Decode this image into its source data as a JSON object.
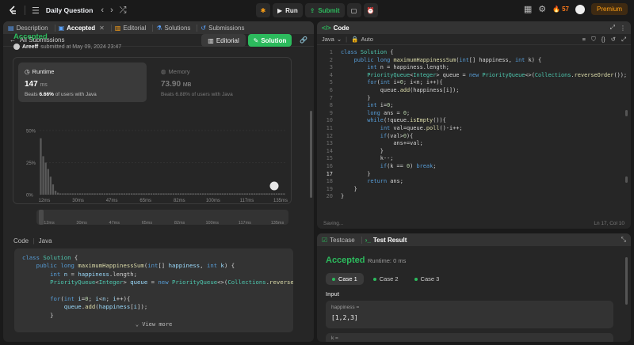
{
  "topbar": {
    "title": "Daily Question",
    "run_label": "Run",
    "submit_label": "Submit",
    "streak": "57",
    "premium_label": "Premium"
  },
  "left_tabs": [
    {
      "label": "Description"
    },
    {
      "label": "Accepted"
    },
    {
      "label": "Editorial"
    },
    {
      "label": "Solutions"
    },
    {
      "label": "Submissions"
    }
  ],
  "submission": {
    "back_label": "All Submissions",
    "status": "Accepted",
    "author": "Areeff",
    "submitted_text": "submitted at May 09, 2024 23:47",
    "editorial_button": "Editorial",
    "solution_button": "Solution"
  },
  "runtime": {
    "label": "Runtime",
    "value": "147",
    "unit": "ms",
    "beats_prefix": "Beats",
    "beats_value": "6.66%",
    "beats_suffix": "of users with Java"
  },
  "memory": {
    "label": "Memory",
    "value": "73.90",
    "unit": "MB",
    "beats_text": "Beats 6.88% of users with Java"
  },
  "chart_data": {
    "type": "bar",
    "y_ticks": [
      "50%",
      "25%",
      "0%"
    ],
    "ylim": [
      0,
      50
    ],
    "x_tick_labels": [
      "12ms",
      "30ms",
      "47ms",
      "65ms",
      "82ms",
      "100ms",
      "117ms",
      "135ms"
    ],
    "overview_tick_labels": [
      "12ms",
      "30ms",
      "47ms",
      "65ms",
      "82ms",
      "100ms",
      "117ms",
      "135ms"
    ],
    "bars": [
      44,
      30,
      25,
      20,
      14,
      8,
      3,
      1.5,
      1,
      1,
      1,
      1,
      1,
      1,
      1,
      1,
      1,
      1,
      1,
      1,
      1,
      1,
      1,
      1,
      1,
      1,
      1,
      1,
      1,
      1,
      1,
      1,
      1,
      1,
      1,
      1,
      1,
      1,
      1,
      1,
      1,
      1,
      1,
      1,
      1,
      1,
      1,
      1,
      1,
      1,
      1,
      1,
      1,
      1,
      1,
      1,
      1,
      1,
      1,
      1,
      1,
      1,
      1,
      1,
      1,
      1,
      1,
      1,
      1,
      1,
      1,
      1,
      1,
      1,
      1,
      1,
      1,
      1,
      1,
      1,
      1,
      1,
      1,
      1,
      1,
      1,
      1,
      1,
      1,
      1,
      1,
      1,
      1,
      1,
      1,
      1,
      1,
      1,
      1,
      1
    ],
    "grid": true
  },
  "code_preview": {
    "label": "Code",
    "language": "Java",
    "lines": [
      "class Solution {",
      "    public long maximumHappinessSum(int[] happiness, int k) {",
      "        int n = happiness.length;",
      "        PriorityQueue<Integer> queue = new PriorityQueue<>(Collections.reverseOrder());",
      "",
      "        for(int i=0; i<n; i++){",
      "            queue.add(happiness[i]);",
      "        }"
    ],
    "view_more": "View more"
  },
  "editor": {
    "tab_label": "Code",
    "language": "Java",
    "mode": "Auto",
    "status_left": "Saving...",
    "status_right": "Ln 17, Col 10",
    "lines": [
      "class Solution {",
      "    public long maximumHappinessSum(int[] happiness, int k) {",
      "        int n = happiness.length;",
      "        PriorityQueue<Integer> queue = new PriorityQueue<>(Collections.reverseOrder());",
      "        for(int i=0; i<n; i++){",
      "            queue.add(happiness[i]);",
      "        }",
      "        int i=0;",
      "        long ans = 0;",
      "        while(!queue.isEmpty()){",
      "            int val=queue.poll()-i++;",
      "            if(val>0){",
      "                ans+=val;",
      "            }",
      "            k--;",
      "            if(k == 0) break;",
      "        }",
      "        return ans;",
      "    }",
      "}"
    ]
  },
  "test": {
    "testcase_tab": "Testcase",
    "result_tab": "Test Result",
    "status": "Accepted",
    "runtime_text": "Runtime: 0 ms",
    "cases": [
      "Case 1",
      "Case 2",
      "Case 3"
    ],
    "input_label": "Input",
    "param1_name": "happiness =",
    "param1_value": "[1,2,3]",
    "param2_name": "k ="
  },
  "colors": {
    "accent_green": "#2cbb5d",
    "premium_orange": "#ffa116",
    "panel_bg": "#262626"
  }
}
